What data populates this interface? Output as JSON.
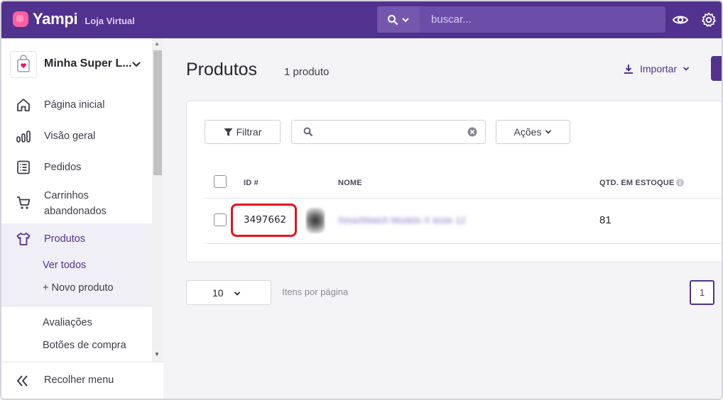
{
  "header": {
    "brand": "Yampi",
    "subtitle": "Loja Virtual",
    "search_placeholder": "buscar..."
  },
  "sidebar": {
    "store_name": "Minha Super L...",
    "items": [
      {
        "label": "Página inicial",
        "icon": "home-icon"
      },
      {
        "label": "Visão geral",
        "icon": "bar-chart-icon"
      },
      {
        "label": "Pedidos",
        "icon": "list-icon"
      },
      {
        "label": "Carrinhos abandonados",
        "icon": "cart-icon"
      },
      {
        "label": "Produtos",
        "icon": "shirt-icon"
      }
    ],
    "products_sub": [
      "Ver todos",
      "+ Novo produto"
    ],
    "extra_items": [
      "Avaliações",
      "Botões de compra"
    ],
    "collapse_label": "Recolher menu"
  },
  "main": {
    "title": "Produtos",
    "count": "1 produto",
    "import_label": "Importar",
    "filter_label": "Filtrar",
    "actions_label": "Ações",
    "columns": [
      "ID #",
      "NOME",
      "QTD. EM ESTOQUE"
    ],
    "rows": [
      {
        "id": "3497662",
        "name": "SmartWatch Modelo X teste 12",
        "qty": "81"
      }
    ],
    "per_page": "10",
    "per_page_label": "Itens por página",
    "current_page": "1"
  },
  "colors": {
    "brand_purple": "#52328f",
    "highlight_red": "#e8121b",
    "logo_pink": "#ff5fa2"
  }
}
